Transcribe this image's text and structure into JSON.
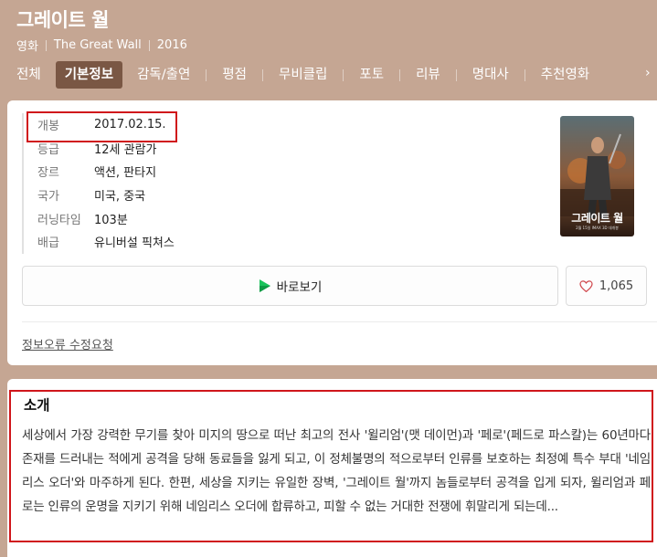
{
  "movie": {
    "title": "그레이트 월",
    "meta": [
      "영화",
      "The Great Wall",
      "2016"
    ]
  },
  "tabs": [
    {
      "label": "전체",
      "active": false
    },
    {
      "label": "기본정보",
      "active": true
    },
    {
      "label": "감독/출연",
      "active": false
    },
    {
      "label": "평점",
      "active": false
    },
    {
      "label": "무비클립",
      "active": false
    },
    {
      "label": "포토",
      "active": false
    },
    {
      "label": "리뷰",
      "active": false
    },
    {
      "label": "명대사",
      "active": false
    },
    {
      "label": "추천영화",
      "active": false
    }
  ],
  "info": [
    {
      "label": "개봉",
      "value": "2017.02.15."
    },
    {
      "label": "등급",
      "value": "12세 관람가"
    },
    {
      "label": "장르",
      "value": "액션, 판타지"
    },
    {
      "label": "국가",
      "value": "미국, 중국"
    },
    {
      "label": "러닝타임",
      "value": "103분"
    },
    {
      "label": "배급",
      "value": "유니버설 픽쳐스"
    }
  ],
  "poster": {
    "title_text": "그레이트 월",
    "credit_text": "2월 15일 IMAX 3D 대개봉"
  },
  "actions": {
    "watch_label": "바로보기",
    "like_count": "1,065"
  },
  "report_link": "정보오류 수정요청",
  "intro": {
    "title": "소개",
    "text": "세상에서 가장 강력한 무기를 찾아 미지의 땅으로 떠난 최고의 전사 '윌리엄'(맷 데이먼)과 '페로'(페드로 파스칼)는 60년마다 존재를 드러내는 적에게 공격을 당해 동료들을 잃게 되고, 이 정체불명의 적으로부터 인류를 보호하는 최정예 특수 부대 '네임리스 오더'와 마주하게 된다. 한편, 세상을 지키는 유일한 장벽, '그레이트 월'까지 놈들로부터 공격을 입게 되자, 윌리엄과 페로는 인류의 운명을 지키기 위해 네임리스 오더에 합류하고, 피할 수 없는 거대한 전쟁에 휘말리게 되는데..."
  },
  "colors": {
    "header_bg": "#c5a693",
    "active_tab": "#7a5744",
    "highlight": "#d0161b",
    "play_green": "#19c35b"
  }
}
